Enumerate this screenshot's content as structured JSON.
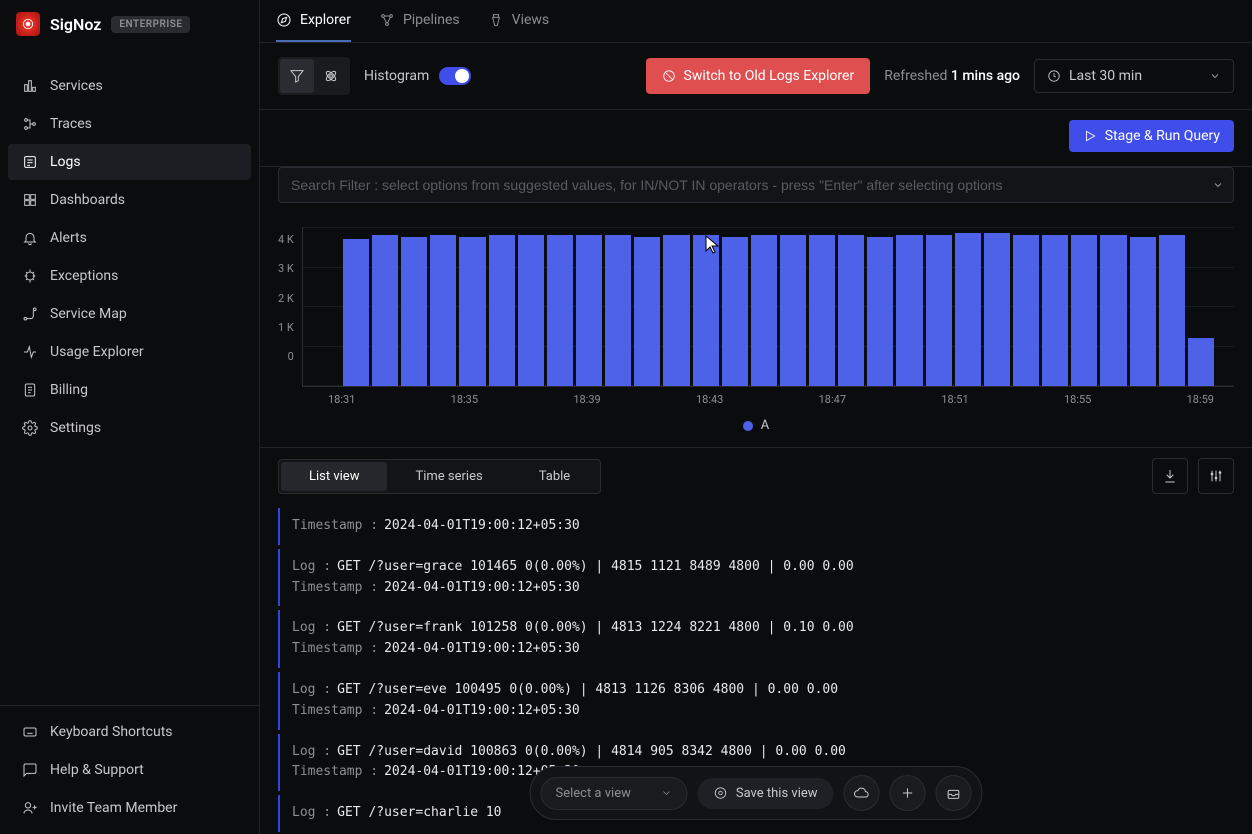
{
  "brand": {
    "name": "SigNoz",
    "badge": "ENTERPRISE"
  },
  "sidebar": {
    "items": [
      {
        "label": "Services"
      },
      {
        "label": "Traces"
      },
      {
        "label": "Logs"
      },
      {
        "label": "Dashboards"
      },
      {
        "label": "Alerts"
      },
      {
        "label": "Exceptions"
      },
      {
        "label": "Service Map"
      },
      {
        "label": "Usage Explorer"
      },
      {
        "label": "Billing"
      },
      {
        "label": "Settings"
      }
    ],
    "footer": [
      {
        "label": "Keyboard Shortcuts"
      },
      {
        "label": "Help & Support"
      },
      {
        "label": "Invite Team Member"
      }
    ]
  },
  "top_tabs": [
    {
      "label": "Explorer"
    },
    {
      "label": "Pipelines"
    },
    {
      "label": "Views"
    }
  ],
  "toolbar": {
    "histogram_label": "Histogram",
    "switch_label": "Switch to Old Logs Explorer",
    "refreshed_prefix": "Refreshed",
    "refreshed_value": "1 mins ago",
    "time_range": "Last 30 min",
    "stage_label": "Stage & Run Query"
  },
  "search": {
    "placeholder": "Search Filter : select options from suggested values, for IN/NOT IN operators - press \"Enter\" after selecting options"
  },
  "chart_data": {
    "type": "bar",
    "series_name": "A",
    "y_ticks": [
      "4 K",
      "3 K",
      "2 K",
      "1 K",
      "0"
    ],
    "x_ticks": [
      "18:31",
      "18:35",
      "18:39",
      "18:43",
      "18:47",
      "18:51",
      "18:55",
      "18:59"
    ],
    "values": [
      3700,
      3800,
      3750,
      3800,
      3750,
      3800,
      3800,
      3800,
      3800,
      3800,
      3750,
      3800,
      3800,
      3750,
      3800,
      3800,
      3800,
      3800,
      3750,
      3800,
      3800,
      3850,
      3850,
      3800,
      3800,
      3800,
      3800,
      3750,
      3800,
      1200
    ],
    "y_max": 4000
  },
  "view_tabs": [
    {
      "label": "List view"
    },
    {
      "label": "Time series"
    },
    {
      "label": "Table"
    }
  ],
  "logs": [
    {
      "ts_key": "Timestamp :",
      "ts": "2024-04-01T19:00:12+05:30"
    },
    {
      "log_key": "Log :",
      "log": "GET /?user=grace 101465 0(0.00%) | 4815 1121 8489 4800 | 0.00 0.00",
      "ts_key": "Timestamp :",
      "ts": "2024-04-01T19:00:12+05:30"
    },
    {
      "log_key": "Log :",
      "log": "GET /?user=frank 101258 0(0.00%) | 4813 1224 8221 4800 | 0.10 0.00",
      "ts_key": "Timestamp :",
      "ts": "2024-04-01T19:00:12+05:30"
    },
    {
      "log_key": "Log :",
      "log": "GET /?user=eve 100495 0(0.00%) | 4813 1126 8306 4800 | 0.00 0.00",
      "ts_key": "Timestamp :",
      "ts": "2024-04-01T19:00:12+05:30"
    },
    {
      "log_key": "Log :",
      "log": "GET /?user=david 100863 0(0.00%) | 4814 905 8342 4800 | 0.00 0.00",
      "ts_key": "Timestamp :",
      "ts": "2024-04-01T19:00:12+05:30"
    },
    {
      "log_key": "Log :",
      "log": "GET /?user=charlie 10"
    }
  ],
  "bottom": {
    "select_placeholder": "Select a view",
    "save_label": "Save this view"
  }
}
